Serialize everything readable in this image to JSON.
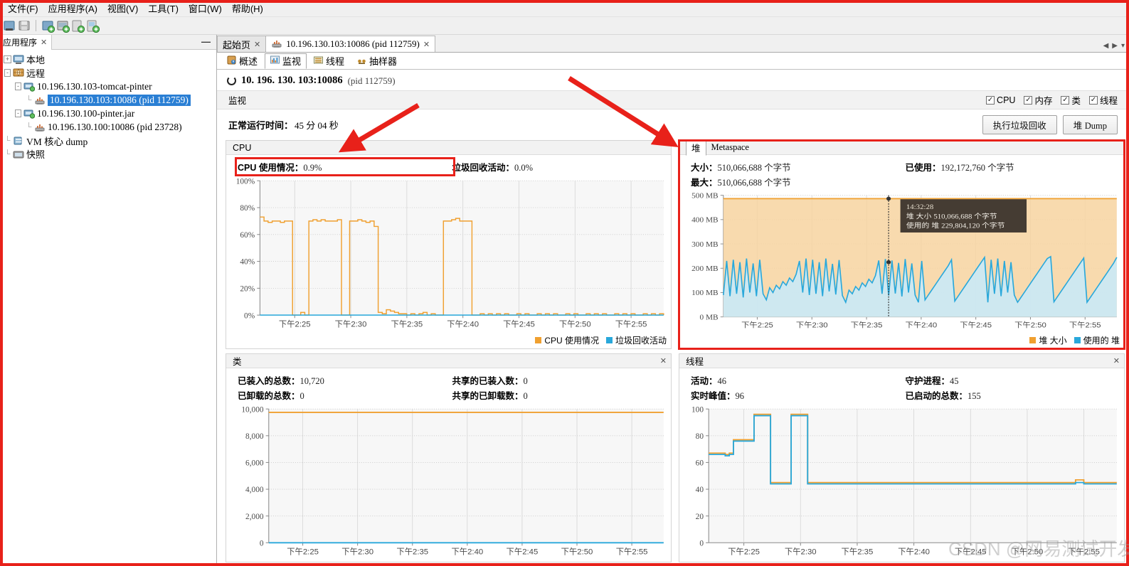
{
  "menubar": {
    "items": [
      {
        "label": "文件(F)",
        "name": "menu-file"
      },
      {
        "label": "应用程序(A)",
        "name": "menu-applications"
      },
      {
        "label": "视图(V)",
        "name": "menu-view"
      },
      {
        "label": "工具(T)",
        "name": "menu-tools"
      },
      {
        "label": "窗口(W)",
        "name": "menu-window"
      },
      {
        "label": "帮助(H)",
        "name": "menu-help"
      }
    ]
  },
  "toolbar": {
    "icons": [
      {
        "name": "new-session-icon"
      },
      {
        "name": "save-icon"
      },
      {
        "name": "add-jmx-connection-icon"
      },
      {
        "name": "add-remote-host-icon"
      },
      {
        "name": "add-vm-coredump-icon"
      },
      {
        "name": "add-snapshot-icon"
      }
    ]
  },
  "sidebar": {
    "tab_label": "应用程序",
    "close_glyph": "✕",
    "minimize_glyph": "—",
    "tree": [
      {
        "label": "本地",
        "icon": "local-computer-icon",
        "depth": 0,
        "handle": "+",
        "selected": false,
        "cjk": true
      },
      {
        "label": "远程",
        "icon": "remote-host-icon",
        "depth": 0,
        "handle": "-",
        "selected": false,
        "cjk": true
      },
      {
        "label": "10.196.130.103-tomcat-pinter",
        "icon": "host-icon",
        "depth": 1,
        "handle": "-",
        "selected": false,
        "cjk": false
      },
      {
        "label": "10.196.130.103:10086 (pid 112759)",
        "icon": "jvm-icon",
        "depth": 2,
        "handle": "",
        "selected": true,
        "cjk": false
      },
      {
        "label": "10.196.130.100-pinter.jar",
        "icon": "host-icon",
        "depth": 1,
        "handle": "-",
        "selected": false,
        "cjk": false
      },
      {
        "label": "10.196.130.100:10086 (pid 23728)",
        "icon": "jvm-icon",
        "depth": 2,
        "handle": "",
        "selected": false,
        "cjk": false
      },
      {
        "label": "VM 核心 dump",
        "icon": "coredump-icon",
        "depth": 0,
        "handle": "",
        "selected": false,
        "cjk": false
      },
      {
        "label": "快照",
        "icon": "snapshot-icon",
        "depth": 0,
        "handle": "",
        "selected": false,
        "cjk": true
      }
    ]
  },
  "doc_tabs": [
    {
      "label": "起始页",
      "active": false,
      "icon": null,
      "cjk": true
    },
    {
      "label": "10.196.130.103:10086 (pid 112759)",
      "active": true,
      "icon": "jvm-icon",
      "cjk": false
    }
  ],
  "sub_tabs": [
    {
      "label": "概述",
      "active": false,
      "icon": "overview-icon"
    },
    {
      "label": "监视",
      "active": true,
      "icon": "monitor-icon"
    },
    {
      "label": "线程",
      "active": false,
      "icon": "threads-icon"
    },
    {
      "label": "抽样器",
      "active": false,
      "icon": "sampler-icon"
    }
  ],
  "process": {
    "title": "10. 196. 130. 103:10086",
    "pid": "(pid 112759)",
    "status_icon": "running-icon"
  },
  "monitor": {
    "section_label": "监视",
    "checkboxes": [
      {
        "label": "CPU",
        "checked": true,
        "name": "checkbox-cpu"
      },
      {
        "label": "内存",
        "checked": true,
        "name": "checkbox-memory"
      },
      {
        "label": "类",
        "checked": true,
        "name": "checkbox-classes"
      },
      {
        "label": "线程",
        "checked": true,
        "name": "checkbox-threads"
      }
    ],
    "uptime_label": "正常运行时间：",
    "uptime_value": "45 分 04 秒",
    "buttons": [
      {
        "label": "执行垃圾回收",
        "name": "perform-gc-button"
      },
      {
        "label": "堆 Dump",
        "name": "heap-dump-button"
      }
    ]
  },
  "panels": {
    "cpu": {
      "title": "CPU",
      "prefix": "CPU",
      "stats": [
        {
          "label": "使用情况：",
          "value": "0.9%"
        },
        {
          "label": "垃圾回收活动：",
          "value": "0.0%"
        }
      ]
    },
    "heap": {
      "tabs": [
        {
          "label": "堆",
          "active": true
        },
        {
          "label": "Metaspace",
          "active": false
        }
      ],
      "stats": [
        {
          "label": "大小：",
          "value": "510,066,688 个字节"
        },
        {
          "label": "已使用：",
          "value": "192,172,760 个字节"
        },
        {
          "label": "最大：",
          "value": "510,066,688 个字节"
        }
      ],
      "tooltip": {
        "time": "14:32:28",
        "rows": [
          {
            "label": "堆 大小",
            "value": "510,066,688 个字节"
          },
          {
            "label": "使用的 堆",
            "value": "229,804,120 个字节"
          }
        ]
      }
    },
    "classes": {
      "title": "类",
      "close_glyph": "✕",
      "stats": [
        {
          "label": "已装入的总数：",
          "value": "10,720"
        },
        {
          "label": "共享的已装入数：",
          "value": "0"
        },
        {
          "label": "已卸载的总数：",
          "value": "0"
        },
        {
          "label": "共享的已卸载数：",
          "value": "0"
        }
      ]
    },
    "threads": {
      "title": "线程",
      "close_glyph": "✕",
      "stats": [
        {
          "label": "活动：",
          "value": "46"
        },
        {
          "label": "守护进程：",
          "value": "45"
        },
        {
          "label": "实时峰值：",
          "value": "96"
        },
        {
          "label": "已启动的总数：",
          "value": "155"
        }
      ]
    }
  },
  "watermark": "CSDN @网易测试开发猿",
  "colors": {
    "orange": "#f0a030",
    "blue": "#29a8db",
    "selection": "#2a7fd4",
    "annotation_red": "#e8211a",
    "heap_fill_orange": "#f7d4a0",
    "heap_fill_blue": "#c9e9f7"
  },
  "chart_data": [
    {
      "type": "line",
      "name": "cpu-chart",
      "title": "CPU",
      "xlabel": "",
      "ylabel": "",
      "ylim": [
        0,
        100
      ],
      "yticks": [
        "0%",
        "20%",
        "40%",
        "60%",
        "80%",
        "100%"
      ],
      "xticks": [
        "下午2:25",
        "下午2:30",
        "下午2:35",
        "下午2:40",
        "下午2:45",
        "下午2:50",
        "下午2:55"
      ],
      "legend": [
        {
          "name": "CPU 使用情况",
          "color": "#f0a030"
        },
        {
          "name": "垃圾回收活动",
          "color": "#29a8db"
        }
      ],
      "series": [
        {
          "name": "CPU 使用情况",
          "color": "#f0a030",
          "values": [
            73,
            70,
            69,
            70,
            70,
            69,
            70,
            70,
            0,
            0,
            2,
            0,
            70,
            71,
            70,
            71,
            70,
            70,
            70,
            71,
            0,
            0,
            70,
            70,
            71,
            70,
            69,
            70,
            66,
            2,
            1,
            4,
            3,
            2,
            1,
            1,
            0,
            1,
            0,
            1,
            2,
            0,
            1,
            0,
            0,
            70,
            70,
            71,
            72,
            70,
            70,
            70,
            0,
            0,
            1,
            0,
            1,
            0,
            1,
            0,
            1,
            0,
            0,
            1,
            0,
            1,
            0,
            0,
            1,
            0,
            1,
            0,
            1,
            0,
            0,
            1,
            0,
            1,
            0,
            0,
            1,
            0,
            1,
            0,
            1,
            0,
            0,
            1,
            0,
            1,
            0,
            1,
            0,
            0,
            1,
            0,
            1,
            0,
            1,
            0
          ]
        },
        {
          "name": "垃圾回收活动",
          "color": "#29a8db",
          "values": [
            0,
            0,
            0,
            0,
            0,
            0,
            0,
            0,
            0,
            0,
            0,
            0,
            0,
            0,
            0,
            0,
            0,
            0,
            0,
            0,
            0,
            0,
            0,
            0,
            0,
            0,
            0,
            0,
            0,
            0,
            0,
            0,
            0,
            0,
            0,
            0,
            0,
            0,
            0,
            0,
            0,
            0,
            0,
            0,
            0,
            0,
            0,
            0,
            0,
            0,
            0,
            0,
            0,
            0,
            0,
            0,
            0,
            0,
            0,
            0,
            0,
            0,
            0,
            0,
            0,
            0,
            0,
            0,
            0,
            0,
            0,
            0,
            0,
            0,
            0,
            0,
            0,
            0,
            0,
            0,
            0,
            0,
            0,
            0,
            0,
            0,
            0,
            0,
            0,
            0,
            0,
            0,
            0,
            0,
            0,
            0,
            0,
            0,
            0,
            0
          ]
        }
      ]
    },
    {
      "type": "area",
      "name": "heap-chart",
      "title": "堆",
      "xlabel": "",
      "ylabel": "",
      "ylim": [
        0,
        500
      ],
      "yticks": [
        "0 MB",
        "100 MB",
        "200 MB",
        "300 MB",
        "400 MB",
        "500 MB"
      ],
      "xticks": [
        "下午2:25",
        "下午2:30",
        "下午2:35",
        "下午2:40",
        "下午2:45",
        "下午2:50",
        "下午2:55"
      ],
      "legend": [
        {
          "name": "堆 大小",
          "color": "#f0a030"
        },
        {
          "name": "使用的 堆",
          "color": "#29a8db"
        }
      ],
      "series": [
        {
          "name": "堆 大小",
          "color": "#f0a030",
          "constant": 486
        },
        {
          "name": "使用的 堆",
          "color": "#29a8db",
          "values": [
            90,
            230,
            85,
            235,
            95,
            225,
            80,
            240,
            100,
            220,
            85,
            235,
            95,
            70,
            120,
            100,
            130,
            115,
            145,
            130,
            160,
            145,
            175,
            230,
            100,
            240,
            90,
            235,
            95,
            225,
            85,
            240,
            105,
            218,
            92,
            234,
            88,
            60,
            110,
            95,
            125,
            110,
            140,
            125,
            155,
            140,
            170,
            232,
            95,
            238,
            88,
            232,
            96,
            222,
            84,
            238,
            100,
            220,
            90,
            60,
            230,
            70,
            90,
            110,
            130,
            150,
            170,
            190,
            210,
            235,
            65,
            85,
            105,
            125,
            145,
            165,
            185,
            205,
            225,
            245,
            60,
            235,
            95,
            240,
            85,
            230,
            100,
            225,
            90,
            60,
            80,
            100,
            120,
            140,
            160,
            180,
            200,
            220,
            240,
            248,
            62,
            82,
            102,
            122,
            142,
            162,
            182,
            202,
            222,
            242,
            60,
            80,
            100,
            120,
            140,
            160,
            180,
            200,
            220,
            245
          ]
        }
      ],
      "cursor": {
        "time": "14:32:28",
        "size": "510,066,688 个字节",
        "used": "229,804,120 个字节"
      }
    },
    {
      "type": "line",
      "name": "classes-chart",
      "title": "类",
      "xlabel": "",
      "ylabel": "",
      "ylim": [
        0,
        11000
      ],
      "yticks": [
        "0",
        "2,000",
        "4,000",
        "6,000",
        "8,000",
        "10,000"
      ],
      "xticks": [
        "下午2:25",
        "下午2:30",
        "下午2:35",
        "下午2:40",
        "下午2:45",
        "下午2:50",
        "下午2:55"
      ],
      "legend": [
        {
          "name": "已装入的总数",
          "color": "#f0a030"
        },
        {
          "name": "共享的已装入数",
          "color": "#29a8db"
        }
      ],
      "series": [
        {
          "name": "已装入的总数",
          "color": "#f0a030",
          "constant": 10720
        },
        {
          "name": "共享的已装入数",
          "color": "#29a8db",
          "constant": 0
        }
      ]
    },
    {
      "type": "line",
      "name": "threads-chart",
      "title": "线程",
      "xlabel": "",
      "ylabel": "",
      "ylim": [
        0,
        100
      ],
      "yticks": [
        "0",
        "20",
        "40",
        "60",
        "80",
        "100"
      ],
      "xticks": [
        "下午2:25",
        "下午2:30",
        "下午2:35",
        "下午2:40",
        "下午2:45",
        "下午2:50",
        "下午2:55"
      ],
      "legend": [
        {
          "name": "活动",
          "color": "#f0a030"
        },
        {
          "name": "守护进程",
          "color": "#29a8db"
        }
      ],
      "series": [
        {
          "name": "活动",
          "color": "#f0a030",
          "values": [
            67,
            67,
            67,
            67,
            66,
            67,
            77,
            77,
            77,
            77,
            77,
            96,
            96,
            96,
            96,
            45,
            45,
            45,
            45,
            45,
            96,
            96,
            96,
            96,
            45,
            45,
            45,
            45,
            45,
            45,
            45,
            45,
            45,
            45,
            45,
            45,
            45,
            45,
            45,
            45,
            45,
            45,
            45,
            45,
            45,
            45,
            45,
            45,
            45,
            45,
            45,
            45,
            45,
            45,
            45,
            45,
            45,
            45,
            45,
            45,
            45,
            45,
            45,
            45,
            45,
            45,
            45,
            45,
            45,
            45,
            45,
            45,
            45,
            45,
            45,
            45,
            45,
            45,
            45,
            45,
            45,
            45,
            45,
            45,
            45,
            45,
            45,
            45,
            45,
            47,
            47,
            45,
            45,
            45,
            45,
            45,
            45,
            45,
            45,
            45
          ]
        },
        {
          "name": "守护进程",
          "color": "#29a8db",
          "values": [
            66,
            66,
            66,
            66,
            65,
            66,
            76,
            76,
            76,
            76,
            76,
            95,
            95,
            95,
            95,
            44,
            44,
            44,
            44,
            44,
            95,
            95,
            95,
            95,
            44,
            44,
            44,
            44,
            44,
            44,
            44,
            44,
            44,
            44,
            44,
            44,
            44,
            44,
            44,
            44,
            44,
            44,
            44,
            44,
            44,
            44,
            44,
            44,
            44,
            44,
            44,
            44,
            44,
            44,
            44,
            44,
            44,
            44,
            44,
            44,
            44,
            44,
            44,
            44,
            44,
            44,
            44,
            44,
            44,
            44,
            44,
            44,
            44,
            44,
            44,
            44,
            44,
            44,
            44,
            44,
            44,
            44,
            44,
            44,
            44,
            44,
            44,
            44,
            44,
            45,
            45,
            44,
            44,
            44,
            44,
            44,
            44,
            44,
            44,
            44
          ]
        }
      ]
    }
  ]
}
